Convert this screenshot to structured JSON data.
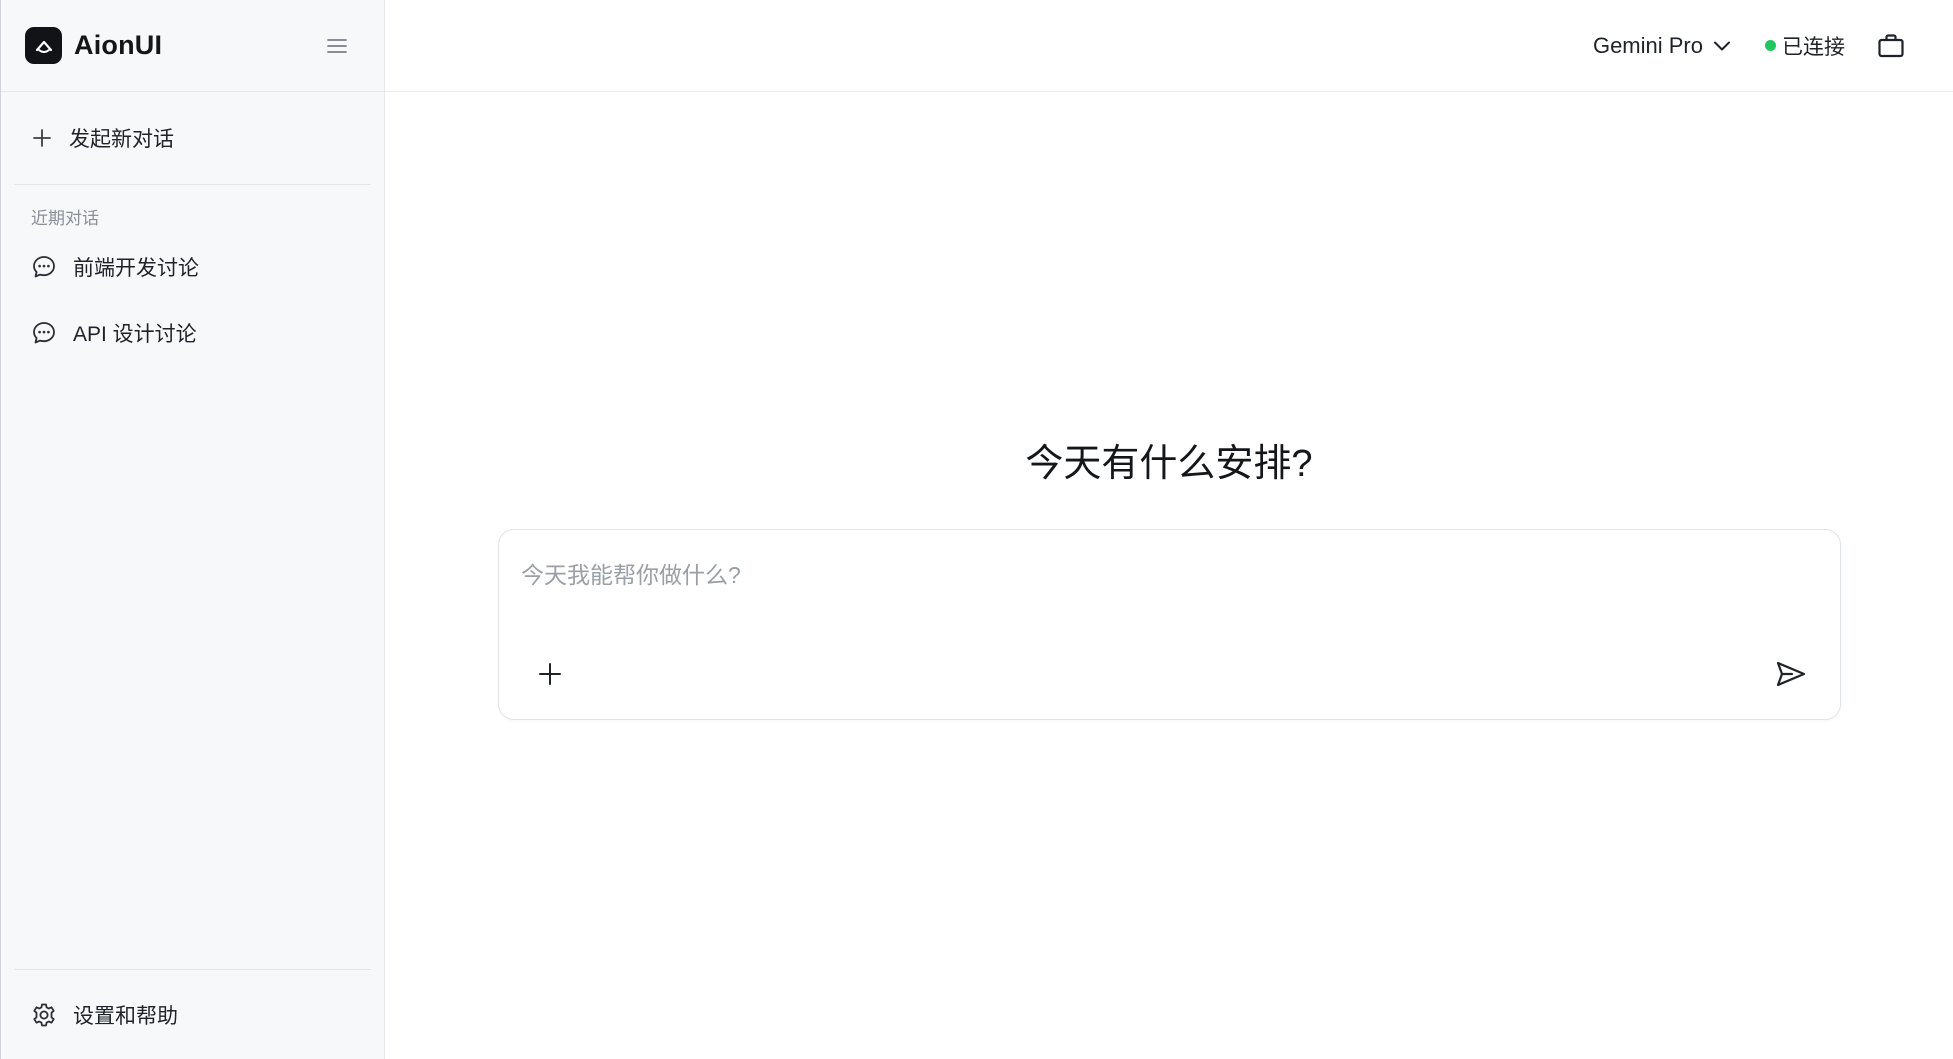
{
  "app": {
    "name": "AionUI"
  },
  "sidebar": {
    "new_chat_label": "发起新对话",
    "section_label": "近期对话",
    "conversations": [
      {
        "label": "前端开发讨论",
        "icon": "chat-bubble-icon"
      },
      {
        "label": "API 设计讨论",
        "icon": "chat-bubble-icon"
      }
    ],
    "settings_label": "设置和帮助"
  },
  "topbar": {
    "model": "Gemini Pro",
    "status_text": "已连接",
    "status_color": "#22c55e"
  },
  "main": {
    "greeting": "今天有什么安排?",
    "input_placeholder": "今天我能帮你做什么?"
  }
}
